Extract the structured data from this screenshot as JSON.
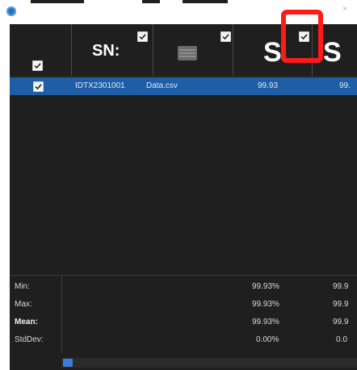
{
  "header": {
    "sn_label": "SN:",
    "col3_label": "S",
    "col4_label": "S"
  },
  "rows": [
    {
      "serial": "IDTX2301001",
      "file": "Data.csv",
      "value": "99.93",
      "value2": "99."
    }
  ],
  "stats": {
    "labels": [
      "Min:",
      "Max:",
      "Mean:",
      "StdDev:"
    ],
    "col1": [
      "99.93%",
      "99.93%",
      "99.93%",
      "0.00%"
    ],
    "col2": [
      "99.9",
      "99.9",
      "99.9",
      "0.0"
    ]
  },
  "colors": {
    "grid_bg": "#1f1f1f",
    "selected_row": "#1f5ea6",
    "highlight": "#ff1a1a",
    "scroll_thumb": "#3b7dd8"
  },
  "icons": {
    "app": "app-icon",
    "list": "list-icon",
    "checkbox": "check-icon"
  }
}
